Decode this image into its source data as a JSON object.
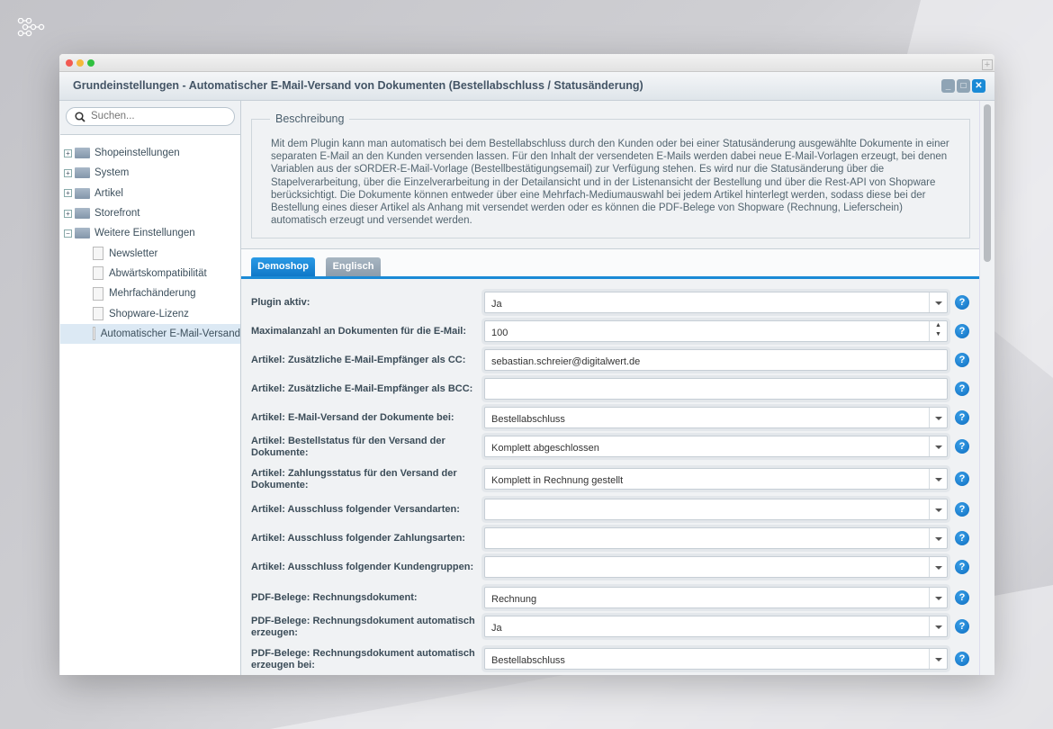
{
  "window": {
    "title": "Grundeinstellungen - Automatischer E-Mail-Versand von Dokumenten (Bestellabschluss / Statusänderung)",
    "controls": [
      "minimize",
      "maximize",
      "close"
    ]
  },
  "sidebar": {
    "search_placeholder": "Suchen...",
    "items": [
      {
        "label": "Shopeinstellungen",
        "type": "folder",
        "expanded": false
      },
      {
        "label": "System",
        "type": "folder",
        "expanded": false
      },
      {
        "label": "Artikel",
        "type": "folder",
        "expanded": false
      },
      {
        "label": "Storefront",
        "type": "folder",
        "expanded": false
      },
      {
        "label": "Weitere Einstellungen",
        "type": "folder",
        "expanded": true
      },
      {
        "label": "Newsletter",
        "type": "leaf"
      },
      {
        "label": "Abwärtskompatibilität",
        "type": "leaf"
      },
      {
        "label": "Mehrfachänderung",
        "type": "leaf"
      },
      {
        "label": "Shopware-Lizenz",
        "type": "leaf"
      },
      {
        "label": "Automatischer E-Mail-Versand",
        "type": "leaf",
        "selected": true
      }
    ]
  },
  "description": {
    "legend": "Beschreibung",
    "text": "Mit dem Plugin kann man automatisch bei dem Bestellabschluss durch den Kunden oder bei einer Statusänderung ausgewählte Dokumente in einer separaten E-Mail an den Kunden versenden lassen. Für den Inhalt der versendeten E-Mails werden dabei neue E-Mail-Vorlagen erzeugt, bei denen Variablen aus der sORDER-E-Mail-Vorlage (Bestellbestätigungsemail) zur Verfügung stehen. Es wird nur die Statusänderung über die Stapelverarbeitung, über die Einzelverarbeitung in der Detailansicht und in der Listenansicht der Bestellung und über die Rest-API von Shopware berücksichtigt. Die Dokumente können entweder über eine Mehrfach-Mediumauswahl bei jedem Artikel hinterlegt werden, sodass diese bei der Bestellung eines dieser Artikel als Anhang mit versendet werden oder es können die PDF-Belege von Shopware (Rechnung, Lieferschein) automatisch erzeugt und versendet werden."
  },
  "tabs": [
    {
      "label": "Demoshop",
      "active": true
    },
    {
      "label": "Englisch",
      "active": false
    }
  ],
  "form": [
    {
      "label": "Plugin aktiv:",
      "value": "Ja",
      "type": "select"
    },
    {
      "label": "Maximalanzahl an Dokumenten für die E-Mail:",
      "value": "100",
      "type": "number"
    },
    {
      "label": "Artikel: Zusätzliche E-Mail-Empfänger als CC:",
      "value": "sebastian.schreier@digitalwert.de",
      "type": "text"
    },
    {
      "label": "Artikel: Zusätzliche E-Mail-Empfänger als BCC:",
      "value": "",
      "type": "text"
    },
    {
      "label": "Artikel: E-Mail-Versand der Dokumente bei:",
      "value": "Bestellabschluss",
      "type": "select"
    },
    {
      "label": "Artikel: Bestellstatus für den Versand der Dokumente:",
      "value": "Komplett abgeschlossen",
      "type": "select"
    },
    {
      "label": "Artikel: Zahlungsstatus für den Versand der Dokumente:",
      "value": "Komplett in Rechnung gestellt",
      "type": "select"
    },
    {
      "label": "Artikel: Ausschluss folgender Versandarten:",
      "value": "",
      "type": "select"
    },
    {
      "label": "Artikel: Ausschluss folgender Zahlungsarten:",
      "value": "",
      "type": "select"
    },
    {
      "label": "Artikel: Ausschluss folgender Kundengruppen:",
      "value": "",
      "type": "select"
    },
    {
      "label": "PDF-Belege: Rechnungsdokument:",
      "value": "Rechnung",
      "type": "select"
    },
    {
      "label": "PDF-Belege: Rechnungsdokument automatisch erzeugen:",
      "value": "Ja",
      "type": "select"
    },
    {
      "label": "PDF-Belege: Rechnungsdokument automatisch erzeugen bei:",
      "value": "Bestellabschluss",
      "type": "select"
    }
  ],
  "colors": {
    "accent": "#1a8ad6",
    "help": "#1478c8"
  }
}
